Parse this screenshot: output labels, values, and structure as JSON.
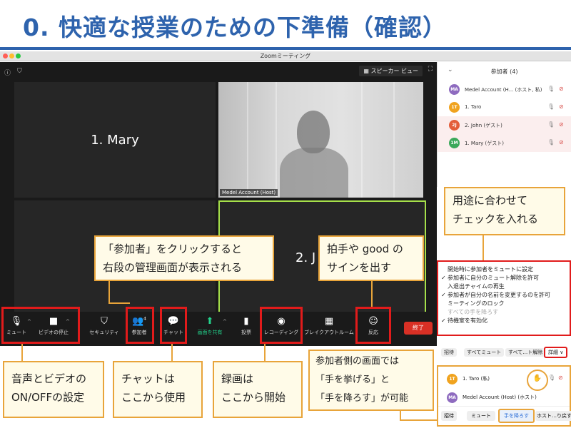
{
  "slide": {
    "title": "0. 快適な授業のための下準備（確認）"
  },
  "window": {
    "title": "Zoomミーティング"
  },
  "zoom": {
    "speaker_view": "スピーカー ビュー",
    "tiles": {
      "mary": "1. Mary",
      "john_partial": "2. J",
      "host_label": "Medel Account (Host)"
    },
    "toolbar": {
      "mute": "ミュート",
      "video": "ビデオの停止",
      "security": "セキュリティ",
      "participants": "参加者",
      "participants_count": "4",
      "chat": "チャット",
      "share": "画面を共有",
      "poll": "投票",
      "record": "レコーディング",
      "breakout": "ブレイクアウトルーム",
      "reactions": "反応",
      "end": "終了"
    }
  },
  "panel": {
    "title": "参加者 (4)",
    "participants": [
      {
        "initials": "MA",
        "name": "Medel Account (H... (ホスト, 私)",
        "color": "#8e6bbf"
      },
      {
        "initials": "1T",
        "name": "1. Taro",
        "color": "#f0a31f"
      },
      {
        "initials": "2J",
        "name": "2. John (ゲスト)",
        "color": "#e35d3a"
      },
      {
        "initials": "1M",
        "name": "1. Mary (ゲスト)",
        "color": "#3aa85a"
      }
    ]
  },
  "menu": {
    "items": [
      {
        "label": "開始時に参加者をミュートに設定",
        "checked": false,
        "dim": false
      },
      {
        "label": "参加者に自分のミュート解除を許可",
        "checked": true,
        "dim": false
      },
      {
        "label": "入退出チャイムの再生",
        "checked": false,
        "dim": false
      },
      {
        "label": "参加者が自分の名前を変更するのを許可",
        "checked": true,
        "dim": false
      },
      {
        "label": "ミーティングのロック",
        "checked": false,
        "dim": false
      },
      {
        "label": "すべての手を降ろす",
        "checked": false,
        "dim": true
      },
      {
        "label": "待機室を有効化",
        "checked": true,
        "dim": false
      }
    ]
  },
  "bottom_bar": {
    "invite": "招待",
    "mute_all": "すべてミュート",
    "unmute_all": "すべて…ト解除",
    "more": "詳細",
    "more_chevron": "∨"
  },
  "bottom_panel": {
    "row1_initials": "1T",
    "row1_name": "1. Taro (私)",
    "row2_initials": "MA",
    "row2_name": "Medel Account (Host) (ホスト)",
    "invite": "招待",
    "mute": "ミュート",
    "lower_hand": "手を降ろす",
    "host_more": "ホスト…り戻す"
  },
  "callouts": {
    "usage": [
      "用途に合わせて",
      "チェックを入れる"
    ],
    "participants": [
      "「参加者」をクリックすると",
      "右段の管理画面が表示される"
    ],
    "applause": [
      "拍手や good の",
      "サインを出す"
    ],
    "av": [
      "音声とビデオの",
      "ON/OFFの設定"
    ],
    "chat": [
      "チャットは",
      "ここから使用"
    ],
    "record": [
      "録画は",
      "ここから開始"
    ],
    "hand": [
      "参加者側の画面では",
      "「手を挙げる」と",
      "「手を降ろす」が可能"
    ]
  },
  "colors": {
    "title_blue": "#2e63ad",
    "callout_border": "#e8a43a",
    "callout_bg": "#fffbe8",
    "highlight_red": "#e11b1b",
    "end_red": "#d93025"
  }
}
